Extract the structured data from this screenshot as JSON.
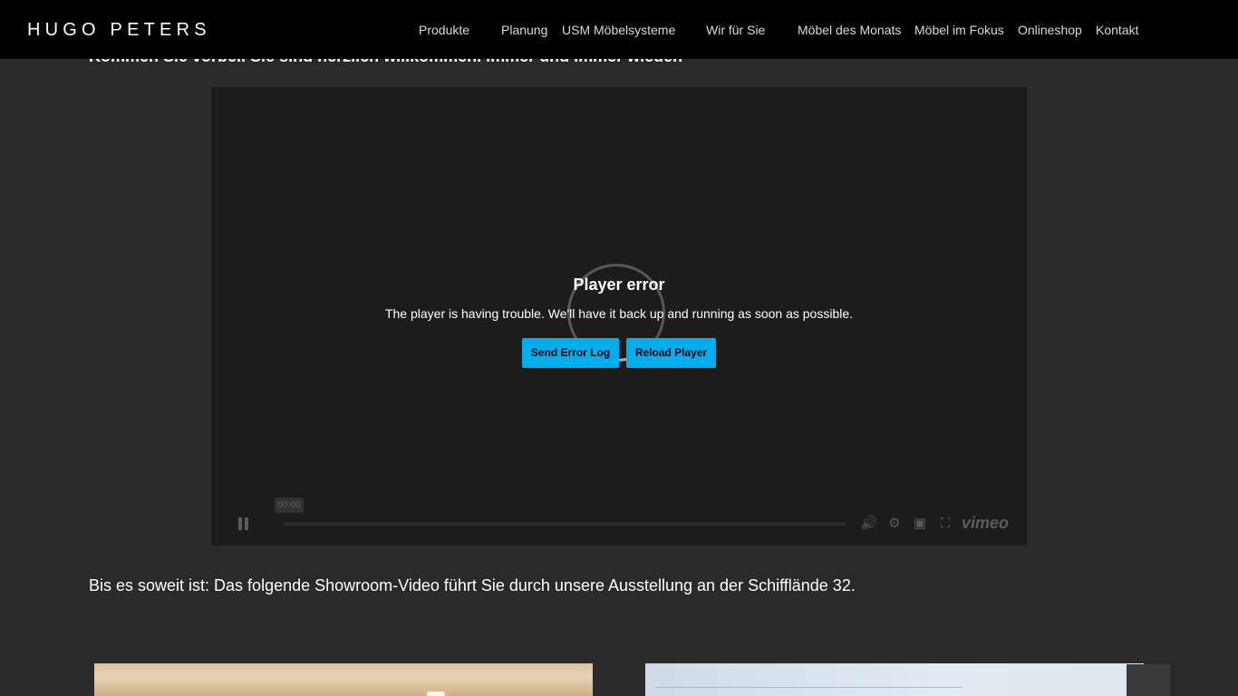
{
  "header": {
    "logo": "HUGO PETERS",
    "nav": [
      "Produkte",
      "Planung",
      "USM Möbelsysteme",
      "Wir für Sie",
      "Möbel des Monats",
      "Möbel im Fokus",
      "Onlineshop",
      "Kontakt"
    ]
  },
  "intro_text": "Kommen Sie vorbei. Sie sind herzlich willkommen. Immer und immer wieder.",
  "player": {
    "error_title": "Player error",
    "error_message": "The player is having trouble. We'll have it back up and running as soon as possible.",
    "send_log_label": "Send Error Log",
    "reload_label": "Reload Player",
    "time": "00:00",
    "brand": "vimeo",
    "accent_color": "#00adef"
  },
  "caption": "Bis es soweit ist: Das folgende Showroom-Video führt Sie durch unsere Ausstellung an der Schifflände 32.",
  "icons": [
    "pause-icon",
    "volume-icon",
    "settings-icon",
    "pip-icon",
    "fullscreen-icon"
  ]
}
